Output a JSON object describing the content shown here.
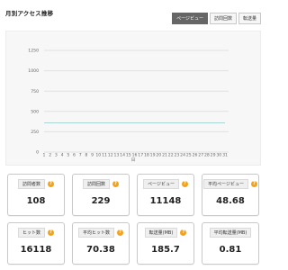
{
  "page": {
    "title": "月別アクセス推移"
  },
  "tabs": [
    {
      "label": "ページビュー",
      "active": true
    },
    {
      "label": "訪問回数",
      "active": false
    },
    {
      "label": "転送量",
      "active": false
    }
  ],
  "chart_data": {
    "type": "line",
    "x": [
      1,
      2,
      3,
      4,
      5,
      6,
      7,
      8,
      9,
      10,
      11,
      12,
      13,
      14,
      15,
      16,
      17,
      18,
      19,
      20,
      21,
      22,
      23,
      24,
      25,
      26,
      27,
      28,
      29,
      30,
      31
    ],
    "x_tick_labels": [
      "1",
      "2",
      "3",
      "4",
      "5",
      "6",
      "7",
      "8",
      "9",
      "10",
      "11",
      "12",
      "13",
      "14",
      "15",
      "16",
      "17",
      "18",
      "19",
      "20",
      "21",
      "22",
      "23",
      "24",
      "25",
      "26",
      "27",
      "28",
      "29",
      "30",
      "31"
    ],
    "xlabel": "日",
    "ylim": [
      0,
      1250
    ],
    "y_ticks": [
      0,
      250,
      500,
      750,
      1000,
      1250
    ],
    "series": [
      {
        "values": [
          360,
          360,
          360,
          360,
          360,
          360,
          360,
          360,
          360,
          360,
          360,
          360,
          360,
          360,
          360,
          360,
          360,
          360,
          360,
          360,
          360,
          360,
          360,
          360,
          360,
          360,
          360,
          360,
          360,
          360,
          360
        ],
        "color": "#9ed4cf"
      }
    ],
    "grid": true
  },
  "stats": [
    {
      "label": "訪問者数",
      "value": "108",
      "help": true
    },
    {
      "label": "訪問回数",
      "value": "229",
      "help": true
    },
    {
      "label": "ページビュー",
      "value": "11148",
      "help": true
    },
    {
      "label": "平均ページビュー",
      "value": "48.68",
      "help": true
    },
    {
      "label": "ヒット数",
      "value": "16118",
      "help": true
    },
    {
      "label": "平均ヒット数",
      "value": "70.38",
      "help": true
    },
    {
      "label": "転送量(MB)",
      "value": "185.7",
      "help": true
    },
    {
      "label": "平均転送量(MB)",
      "value": "0.81",
      "help": false
    }
  ],
  "help_icon_glyph": "?",
  "colors": {
    "accent": "#f4a21a",
    "active_tab": "#666666",
    "line": "#9ed4cf"
  }
}
